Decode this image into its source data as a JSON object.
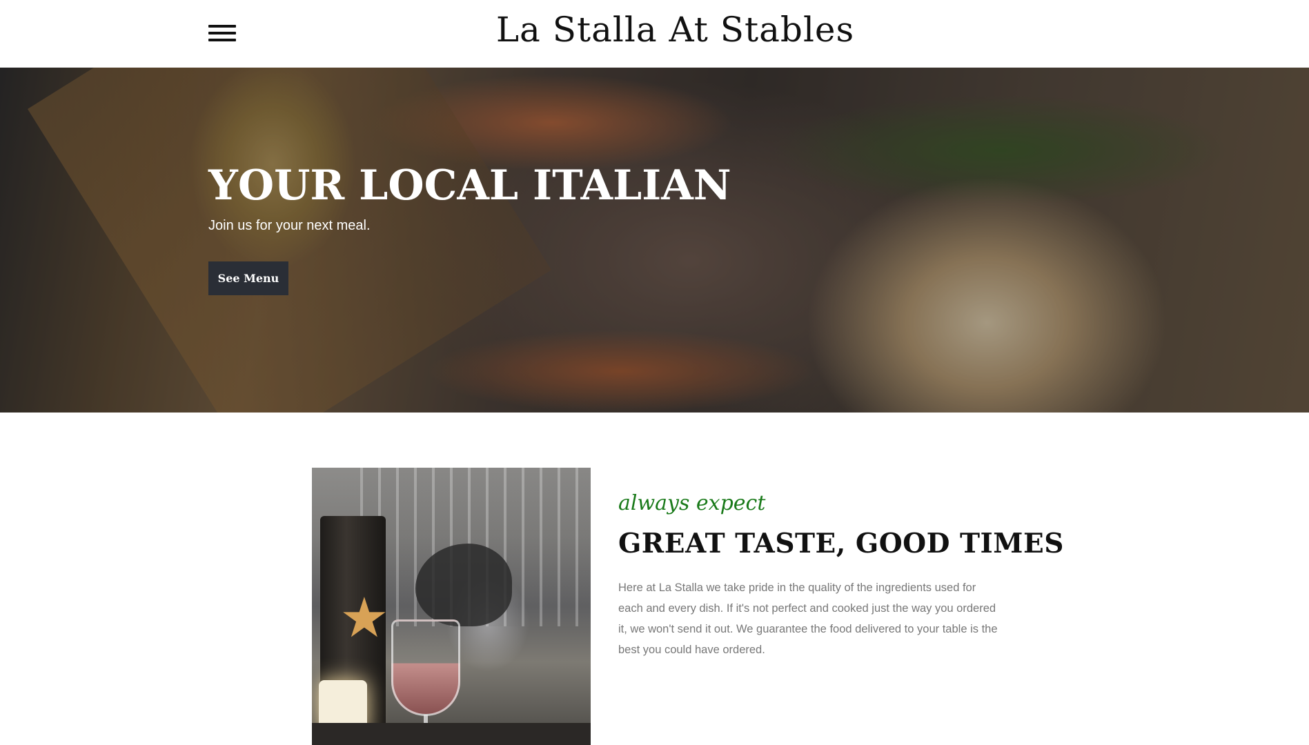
{
  "header": {
    "menu_icon": "hamburger-menu-icon",
    "site_title": "La Stalla At Stables"
  },
  "hero": {
    "title": "YOUR LOCAL ITALIAN",
    "subtitle": "Join us for your next meal.",
    "button_label": "See Menu"
  },
  "about": {
    "eyebrow": "always expect",
    "heading": "GREAT TASTE, GOOD TIMES",
    "body": "Here at La Stalla we take pride in the quality of the ingredients used for each and every dish. If it's not perfect and cooked just the way you ordered it, we won't send it out. We guarantee the food delivered to your table is the best you could have ordered."
  },
  "colors": {
    "accent_green": "#1a7a1a",
    "button_bg": "#2a2e36",
    "body_text": "#777777"
  }
}
